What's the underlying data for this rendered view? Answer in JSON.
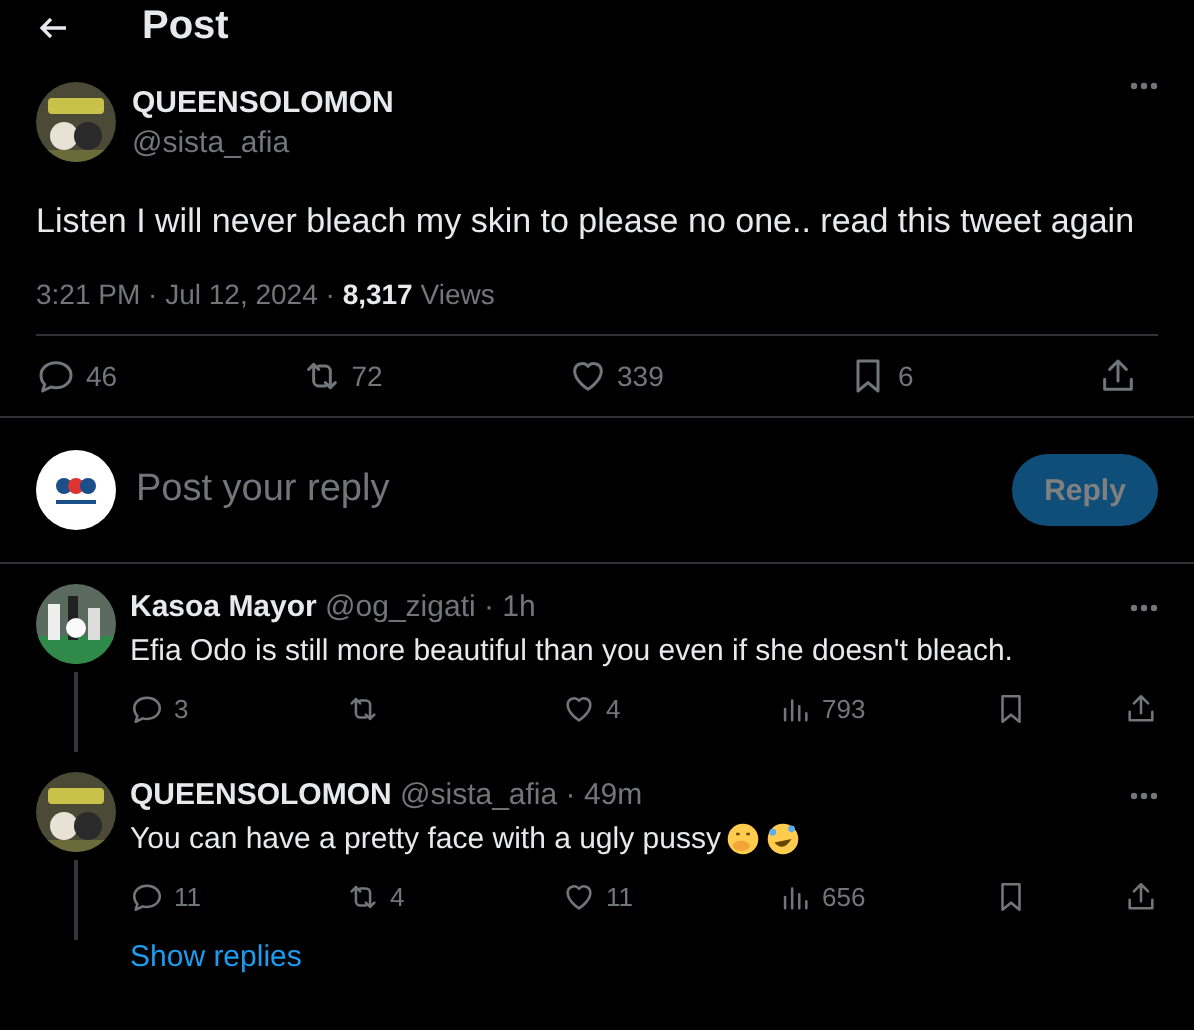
{
  "header": {
    "title": "Post"
  },
  "tweet": {
    "name": "QUEENSOLOMON",
    "handle": "@sista_afia",
    "text": "Listen I will never bleach my skin to please no one.. read this tweet again",
    "time": "3:21 PM · Jul 12, 2024 · ",
    "views_count": "8,317",
    "views_label": " Views",
    "actions": [
      {
        "kind": "reply",
        "count": "46"
      },
      {
        "kind": "repost",
        "count": "72"
      },
      {
        "kind": "like",
        "count": "339"
      },
      {
        "kind": "bookmark",
        "count": "6"
      },
      {
        "kind": "share"
      }
    ]
  },
  "composer": {
    "placeholder": "Post your reply",
    "button": "Reply",
    "disabled": true
  },
  "replies": [
    {
      "name": "Kasoa Mayor",
      "handle": "@og_zigati",
      "age": " · 1h",
      "text": "Efia Odo is still more beautiful than you even if she doesn't bleach.",
      "actions": [
        {
          "kind": "reply",
          "count": "3"
        },
        {
          "kind": "repost"
        },
        {
          "kind": "like",
          "count": "4"
        },
        {
          "kind": "views",
          "count": "793"
        },
        {
          "kind": "bookmark"
        },
        {
          "kind": "share"
        }
      ]
    },
    {
      "name": "QUEENSOLOMON",
      "handle": "@sista_afia",
      "age": " · 49m",
      "text": "You can have a pretty face with a ugly pussy",
      "emojis": [
        {
          "kind": "hand-over-mouth"
        },
        {
          "kind": "rolling-laughing"
        }
      ],
      "actions": [
        {
          "kind": "reply",
          "count": "11"
        },
        {
          "kind": "repost",
          "count": "4"
        },
        {
          "kind": "like",
          "count": "11"
        },
        {
          "kind": "views",
          "count": "656"
        },
        {
          "kind": "bookmark"
        },
        {
          "kind": "share"
        }
      ]
    }
  ],
  "show_replies": "Show replies"
}
